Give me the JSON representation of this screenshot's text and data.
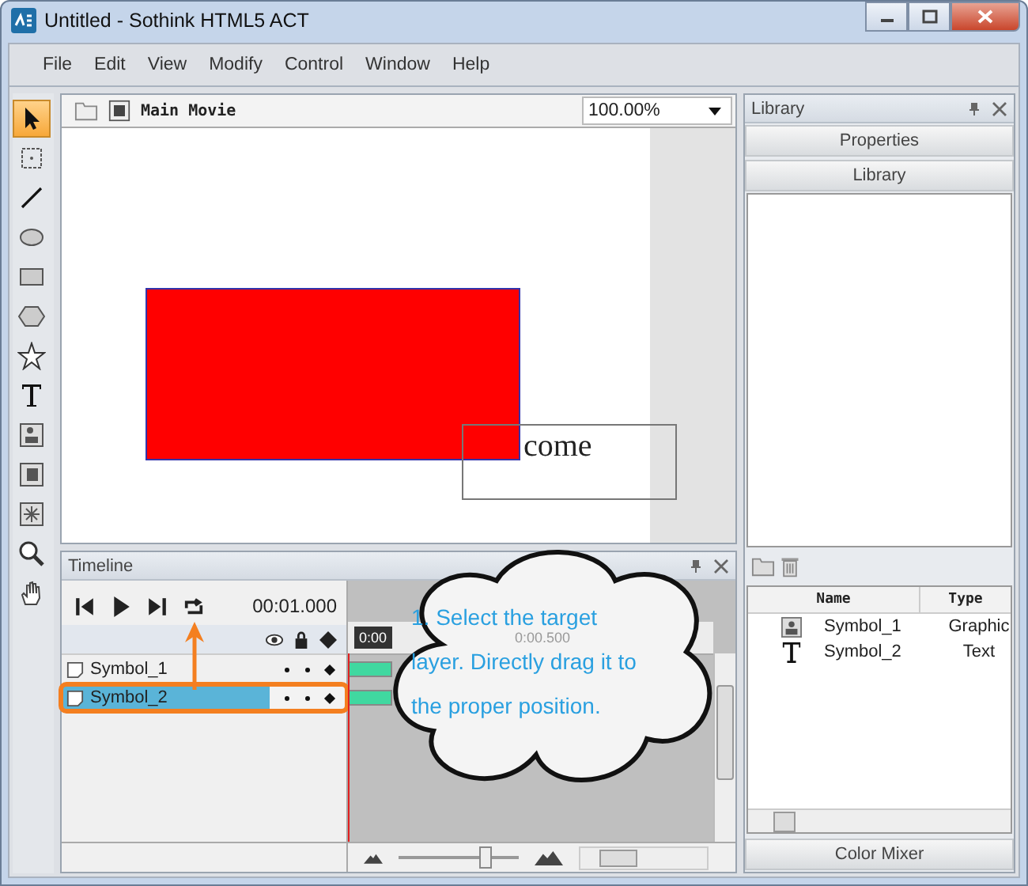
{
  "window": {
    "title": "Untitled - Sothink HTML5 ACT"
  },
  "menu": [
    "File",
    "Edit",
    "View",
    "Modify",
    "Control",
    "Window",
    "Help"
  ],
  "tools": [
    {
      "kind": "pointer",
      "selected": true
    },
    {
      "kind": "transform",
      "selected": false
    },
    {
      "kind": "line",
      "selected": false
    },
    {
      "kind": "ellipse",
      "selected": false
    },
    {
      "kind": "rectangle",
      "selected": false
    },
    {
      "kind": "polygon",
      "selected": false
    },
    {
      "kind": "star",
      "selected": false
    },
    {
      "kind": "text",
      "selected": false
    },
    {
      "kind": "symbol",
      "selected": false
    },
    {
      "kind": "frame",
      "selected": false
    },
    {
      "kind": "effect",
      "selected": false
    },
    {
      "kind": "zoom",
      "selected": false
    },
    {
      "kind": "hand",
      "selected": false
    }
  ],
  "stage": {
    "breadcrumb": "Main Movie",
    "zoom": "100.00%",
    "text_box": "come"
  },
  "timeline": {
    "title": "Timeline",
    "time": "00:01.000",
    "playhead": "0:00",
    "ruler_mark": "0:00.500",
    "zoom_slider": {
      "level": 0.72
    },
    "layers": [
      {
        "name": "Symbol_1",
        "selected": false
      },
      {
        "name": "Symbol_2",
        "selected": true
      }
    ]
  },
  "library": {
    "title": "Library",
    "sections": [
      "Properties",
      "Library"
    ],
    "columns": [
      "Name",
      "Type"
    ],
    "items": [
      {
        "kind": "graphic",
        "name": "Symbol_1",
        "type": "Graphic"
      },
      {
        "kind": "text",
        "name": "Symbol_2",
        "type": "Text"
      }
    ],
    "footer": "Color Mixer"
  },
  "callout": {
    "lines": [
      "1. Select the target",
      "layer. Directly drag it to",
      "the proper position."
    ]
  }
}
